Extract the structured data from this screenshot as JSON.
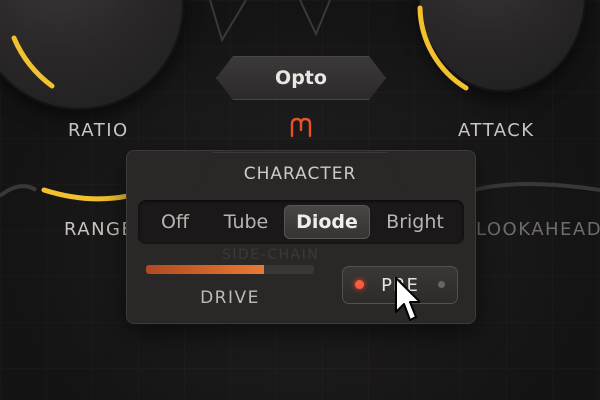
{
  "colors": {
    "accent": "#f2c12e",
    "background": "#1b1a1b",
    "drive_fill": "#e0702e",
    "pre_led": "#ff5a3c",
    "link_icon": "#e5532b"
  },
  "knobs": {
    "ratio": {
      "label": "RATIO"
    },
    "attack": {
      "label": "ATTACK"
    },
    "range": {
      "label": "RANGE"
    },
    "lookahead": {
      "label": "LOOKAHEAD"
    }
  },
  "mode": {
    "label": "Opto"
  },
  "icons": {
    "link": "link-icon",
    "cursor": "cursor-arrow-icon"
  },
  "character": {
    "title": "CHARACTER",
    "options": [
      "Off",
      "Tube",
      "Diode",
      "Bright"
    ],
    "selected": "Diode",
    "drive": {
      "label": "DRIVE",
      "value_fraction": 0.7
    },
    "pre": {
      "label": "PRE",
      "active": true
    }
  },
  "background_text": {
    "sidechain": "SIDE-CHAIN"
  }
}
